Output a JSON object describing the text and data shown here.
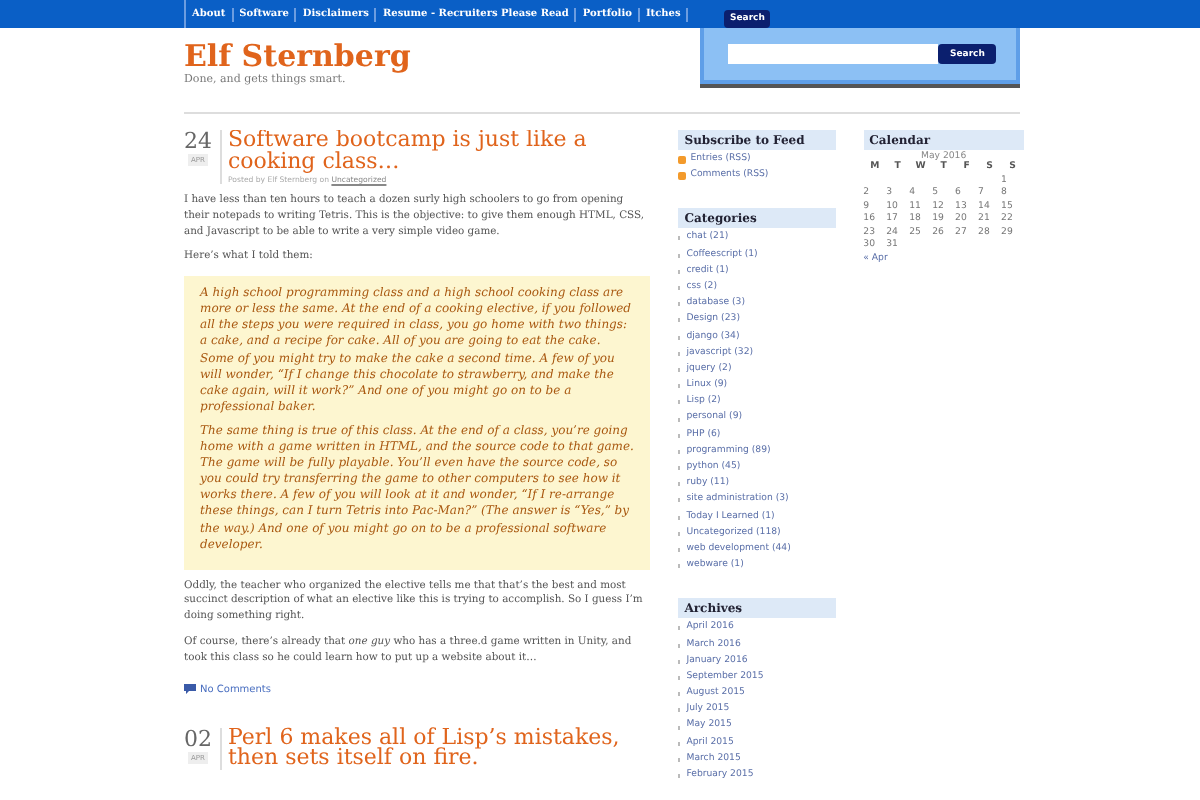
{
  "nav": [
    {
      "label": "About"
    },
    {
      "label": "Software"
    },
    {
      "label": "Disclaimers"
    },
    {
      "label": "Resume - Recruiters Please Read"
    },
    {
      "label": "Portfolio"
    },
    {
      "label": "Itches"
    }
  ],
  "site": {
    "title": "Elf Sternberg",
    "tagline": "Done, and gets things smart."
  },
  "search": {
    "tab": "Search",
    "button": "Search"
  },
  "posts": [
    {
      "day": "24",
      "month": "APR",
      "title": "Software bootcamp is just like a cooking class…",
      "byline": "Posted by Elf Sternberg on",
      "category": "Uncategorized",
      "blocks": [
        {
          "kind": "paragraph",
          "text": "I have less than ten hours to teach a dozen surly high schoolers to go from opening their notepads to writing Tetris. This is the objective: to give them enough HTML, CSS, and Javascript to be able to write a very simple video game."
        },
        {
          "kind": "paragraph",
          "text": "Here’s what I told them:"
        },
        {
          "kind": "quote",
          "paragraphs": [
            "A high school programming class and a high school cooking class are more or less the same. At the end of a cooking elective, if you followed all the steps you were required in class, you go home with two things: a cake, and a recipe for cake. All of you are going to eat the cake. Some of you might try to make the cake a second time. A few of you will wonder, “If I change this chocolate to strawberry, and make the cake again, will it work?” And one of you might go on to be a professional baker.",
            "The same thing is true of this class. At the end of a class, you’re going home with a game written in HTML, and the source code to that game. The game will be fully playable. You’ll even have the source code, so you could try transferring the game to other computers to see how it works there. A few of you will look at it and wonder, “If I re-arrange these things, can I turn Tetris into Pac-Man?” (The answer is “Yes,” by the way.) And one of you might go on to be a professional software developer."
          ]
        },
        {
          "kind": "paragraph",
          "text": "Oddly, the teacher who organized the elective tells me that that’s the best and most succinct description of what an elective like this is trying to accomplish. So I guess I’m doing something right."
        },
        {
          "kind": "paragraph",
          "text": "Of course, there’s already that *one guy* who has a three.d game written in Unity, and took this class so he could learn how to put up a website about it…"
        }
      ],
      "comments": "No Comments"
    },
    {
      "day": "02",
      "month": "APR",
      "title": "Perl 6 makes all of Lisp’s mistakes, then sets itself on fire."
    }
  ],
  "widgets": [
    {
      "title": "Subscribe to Feed",
      "kind": "feeds",
      "items": [
        "Entries (RSS)",
        "Comments (RSS)"
      ]
    },
    {
      "title": "Categories",
      "kind": "list",
      "items": [
        "chat (21)",
        "Coffeescript (1)",
        "credit (1)",
        "css (2)",
        "database (3)",
        "Design (23)",
        "django (34)",
        "javascript (32)",
        "jquery (2)",
        "Linux (9)",
        "Lisp (2)",
        "personal (9)",
        "PHP (6)",
        "programming (89)",
        "python (45)",
        "ruby (11)",
        "site administration (3)",
        "Today I Learned (1)",
        "Uncategorized (118)",
        "web development (44)",
        "webware (1)"
      ]
    },
    {
      "title": "Archives",
      "kind": "list",
      "items": [
        "April 2016",
        "March 2016",
        "January 2016",
        "September 2015",
        "August 2015",
        "July 2015",
        "May 2015",
        "April 2015",
        "March 2015",
        "February 2015"
      ]
    }
  ],
  "calendar": {
    "title": "Calendar",
    "month": "May 2016",
    "weekdays": [
      "M",
      "T",
      "W",
      "T",
      "F",
      "S",
      "S"
    ],
    "weeks": [
      {
        "kind": "first",
        "days": [
          "1"
        ]
      },
      {
        "kind": "full",
        "days": [
          "2",
          "3",
          "4",
          "5",
          "6",
          "7",
          "8"
        ]
      },
      {
        "kind": "full",
        "days": [
          "9",
          "10",
          "11",
          "12",
          "13",
          "14",
          "15"
        ]
      },
      {
        "kind": "full",
        "days": [
          "16",
          "17",
          "18",
          "19",
          "20",
          "21",
          "22"
        ]
      },
      {
        "kind": "full",
        "days": [
          "23",
          "24",
          "25",
          "26",
          "27",
          "28",
          "29"
        ]
      },
      {
        "kind": "last",
        "days": [
          "30",
          "31"
        ]
      }
    ],
    "prev": "« Apr"
  }
}
